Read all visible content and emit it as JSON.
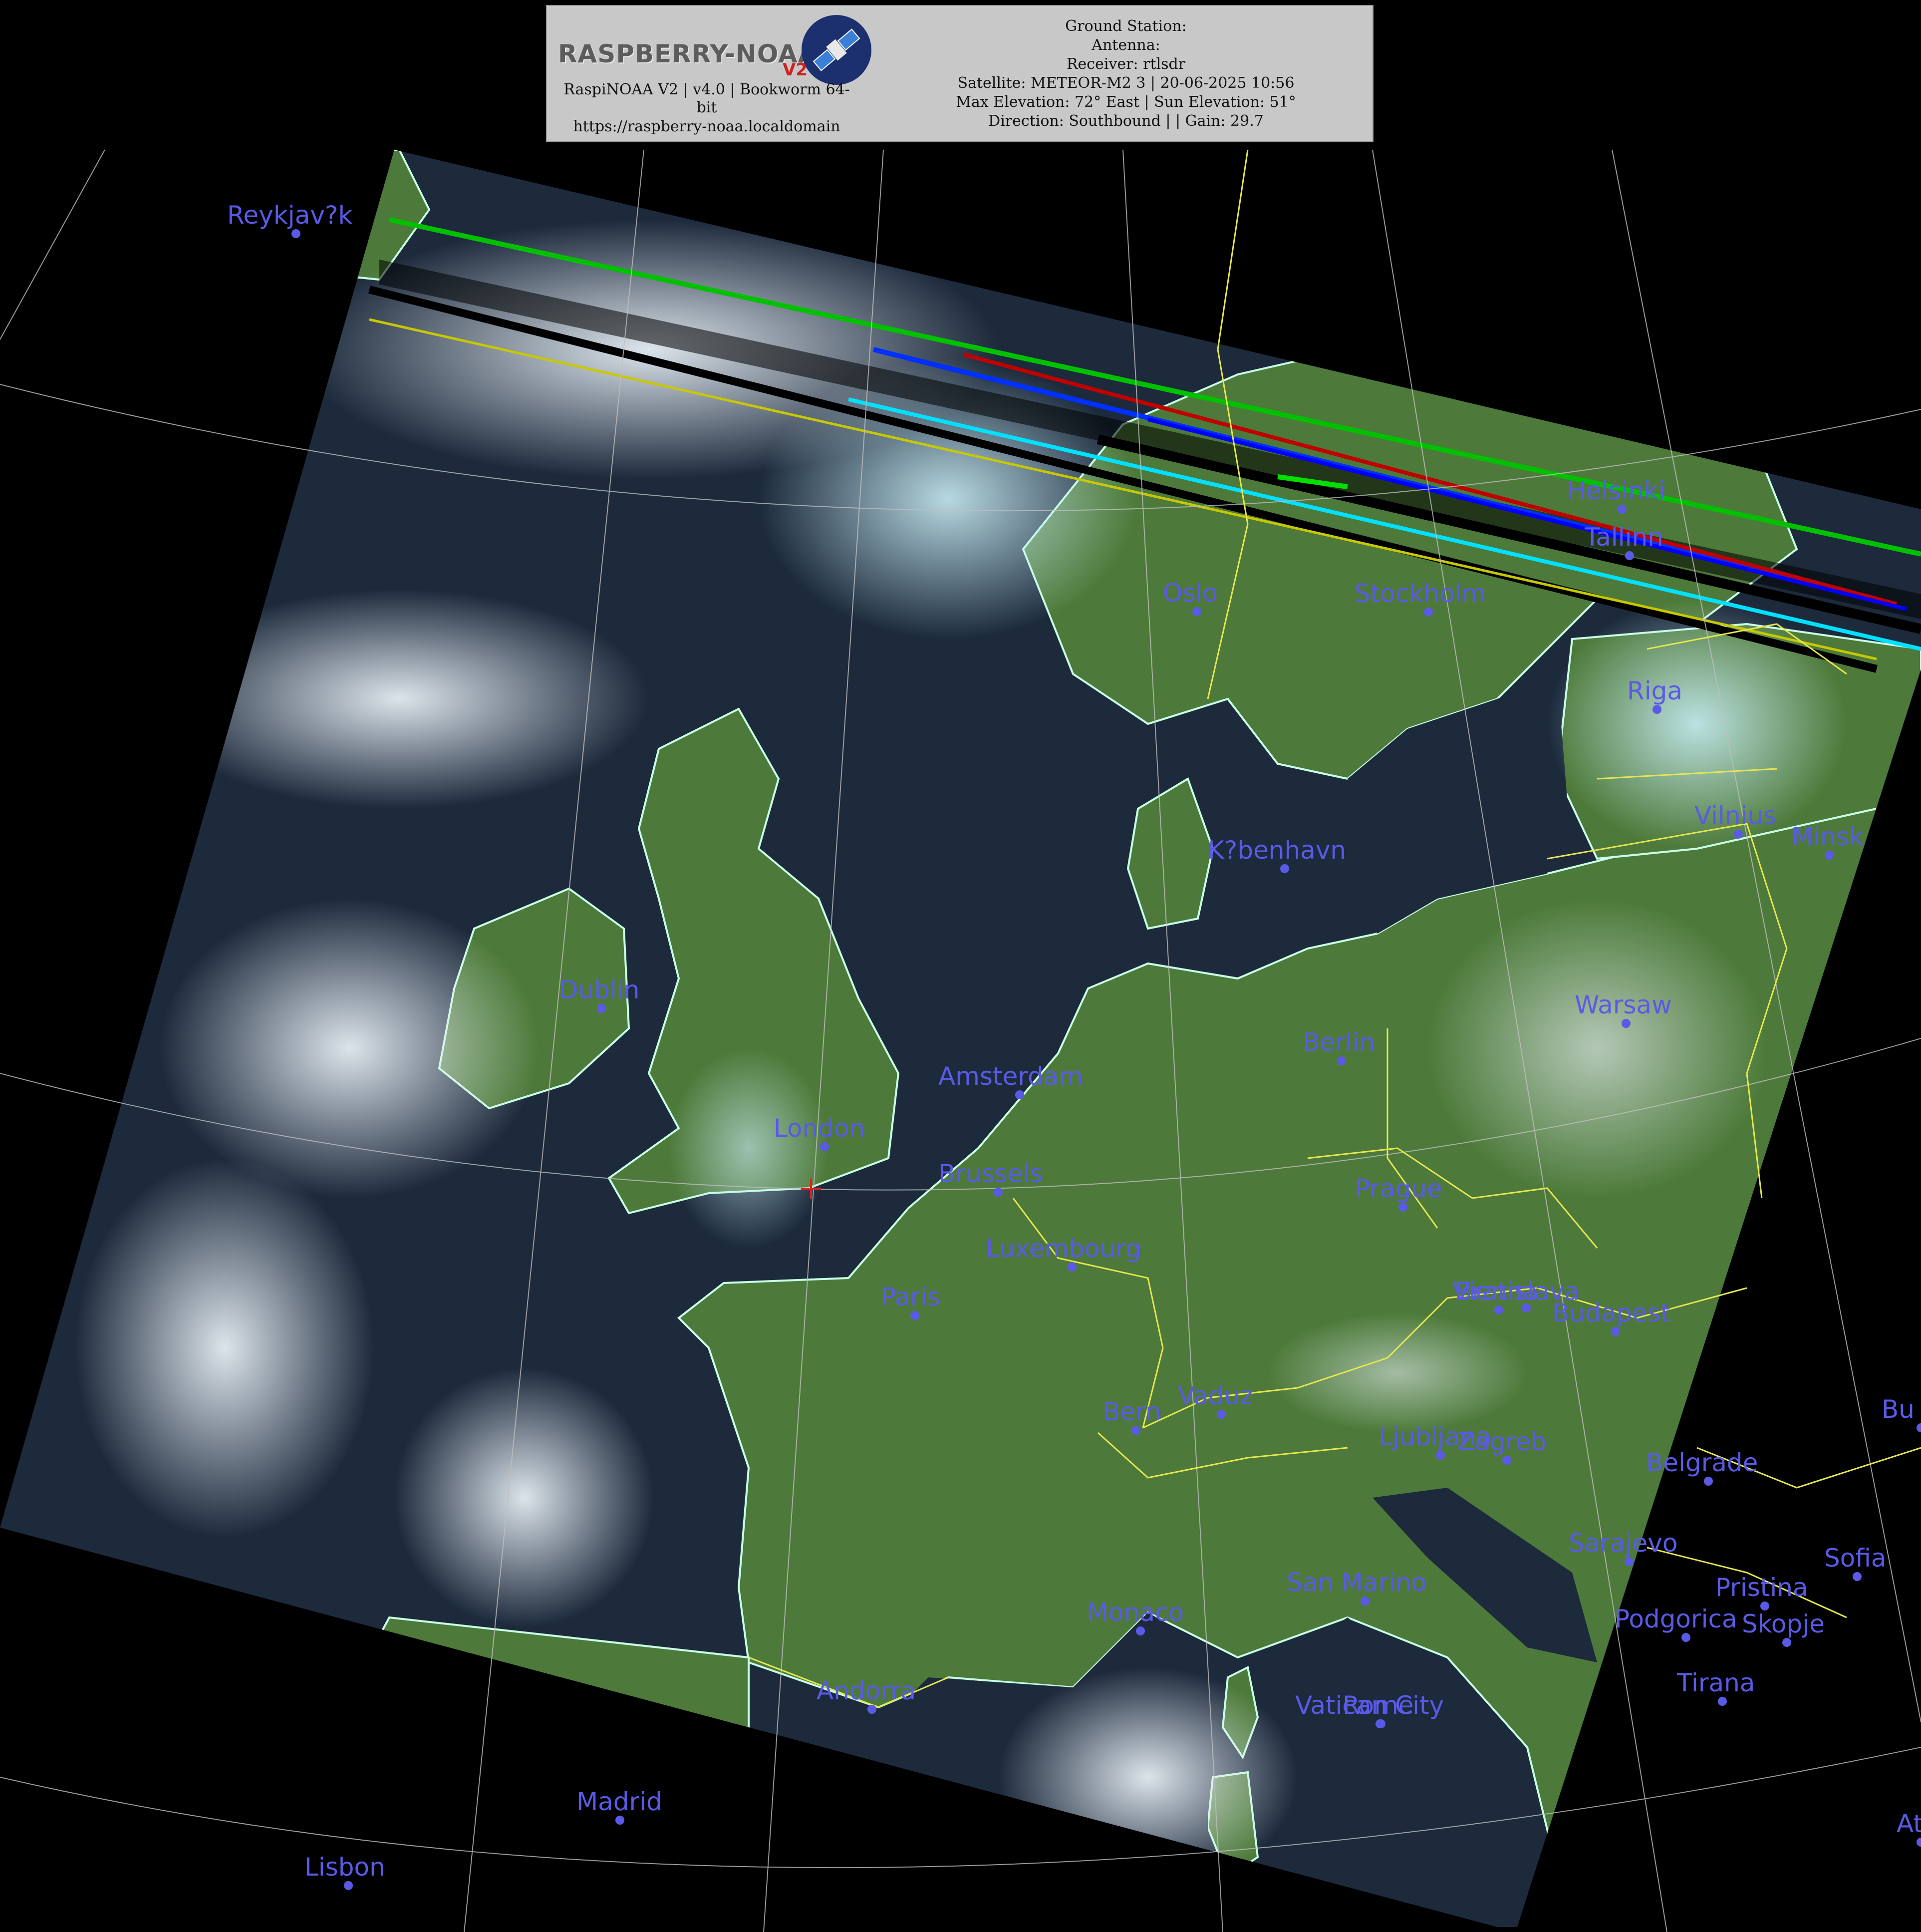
{
  "header": {
    "logo_text": "RASPBERRY-NOAA",
    "logo_badge": "V2",
    "system_line1": "RaspiNOAA V2 | v4.0 | Bookworm 64-",
    "system_line2": "bit",
    "url": "https://raspberry-noaa.localdomain",
    "ground_station": "Ground Station:",
    "antenna": "Antenna:",
    "receiver": "Receiver: rtlsdr",
    "satellite": "Satellite: METEOR-M2 3 | 20-06-2025 10:56",
    "elevation": "Max Elevation: 72° East | Sun Elevation: 51°",
    "direction": "Direction: Southbound | | Gain: 29.7"
  },
  "colors": {
    "city_label": "#5a5ae6",
    "coastline": "#c8ffe6",
    "border": "#e6e650",
    "graticule": "#bfbfbf",
    "sea": "#1c2a3c",
    "land": "#4d7a3a",
    "cloud": "#d8e4ec"
  },
  "map": {
    "center_marker": "red-cross",
    "cities": [
      {
        "name": "Reykjav?k"
      },
      {
        "name": "Helsinki"
      },
      {
        "name": "Tallinn"
      },
      {
        "name": "Oslo"
      },
      {
        "name": "Stockholm"
      },
      {
        "name": "Riga"
      },
      {
        "name": "Vilnius"
      },
      {
        "name": "Minsk"
      },
      {
        "name": "K?benhavn"
      },
      {
        "name": "Dublin"
      },
      {
        "name": "Warsaw"
      },
      {
        "name": "Berlin"
      },
      {
        "name": "Amsterdam"
      },
      {
        "name": "London"
      },
      {
        "name": "Brussels"
      },
      {
        "name": "Prague"
      },
      {
        "name": "Luxembourg"
      },
      {
        "name": "Paris"
      },
      {
        "name": "Vienna"
      },
      {
        "name": "Bratislava"
      },
      {
        "name": "Budapest"
      },
      {
        "name": "Bern"
      },
      {
        "name": "Vaduz"
      },
      {
        "name": "Ljubljana"
      },
      {
        "name": "Zagreb"
      },
      {
        "name": "Belgrade"
      },
      {
        "name": "Bu"
      },
      {
        "name": "Sarajevo"
      },
      {
        "name": "Sofia"
      },
      {
        "name": "San Marino"
      },
      {
        "name": "Pristina"
      },
      {
        "name": "Monaco"
      },
      {
        "name": "Podgorica"
      },
      {
        "name": "Skopje"
      },
      {
        "name": "Tirana"
      },
      {
        "name": "Andorra"
      },
      {
        "name": "Vatican City"
      },
      {
        "name": "Rome"
      },
      {
        "name": "Madrid"
      },
      {
        "name": "Lisbon"
      },
      {
        "name": "At"
      }
    ]
  }
}
